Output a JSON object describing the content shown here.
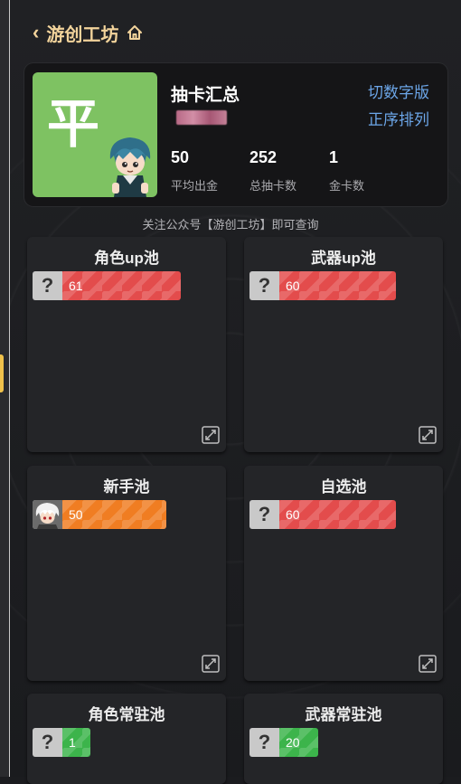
{
  "header": {
    "title": "游创工坊"
  },
  "summary": {
    "badge": "平",
    "title": "抽卡汇总",
    "toggle_font": "切数字版",
    "toggle_order": "正序排列",
    "stats": [
      {
        "value": "50",
        "label": "平均出金"
      },
      {
        "value": "252",
        "label": "总抽卡数"
      },
      {
        "value": "1",
        "label": "金卡数"
      }
    ]
  },
  "notice": "关注公众号【游创工坊】即可查询",
  "pools": [
    {
      "name": "角色up池",
      "entry": {
        "icon": "?",
        "count": "61",
        "color": "red"
      }
    },
    {
      "name": "武器up池",
      "entry": {
        "icon": "?",
        "count": "60",
        "color": "red"
      }
    },
    {
      "name": "新手池",
      "entry": {
        "icon": "character-portrait",
        "count": "50",
        "color": "orange"
      }
    },
    {
      "name": "自选池",
      "entry": {
        "icon": "?",
        "count": "60",
        "color": "red"
      }
    },
    {
      "name": "角色常驻池",
      "entry": {
        "icon": "?",
        "count": "1",
        "color": "green"
      }
    },
    {
      "name": "武器常驻池",
      "entry": {
        "icon": "?",
        "count": "20",
        "color": "green"
      }
    }
  ],
  "colors": {
    "accent_gold": "#f2d39b",
    "link_blue": "#6ca6e8",
    "badge_green": "#7ec262",
    "bar_red": "#e34c4c",
    "bar_orange": "#f07d22",
    "bar_green": "#3cb44b"
  }
}
